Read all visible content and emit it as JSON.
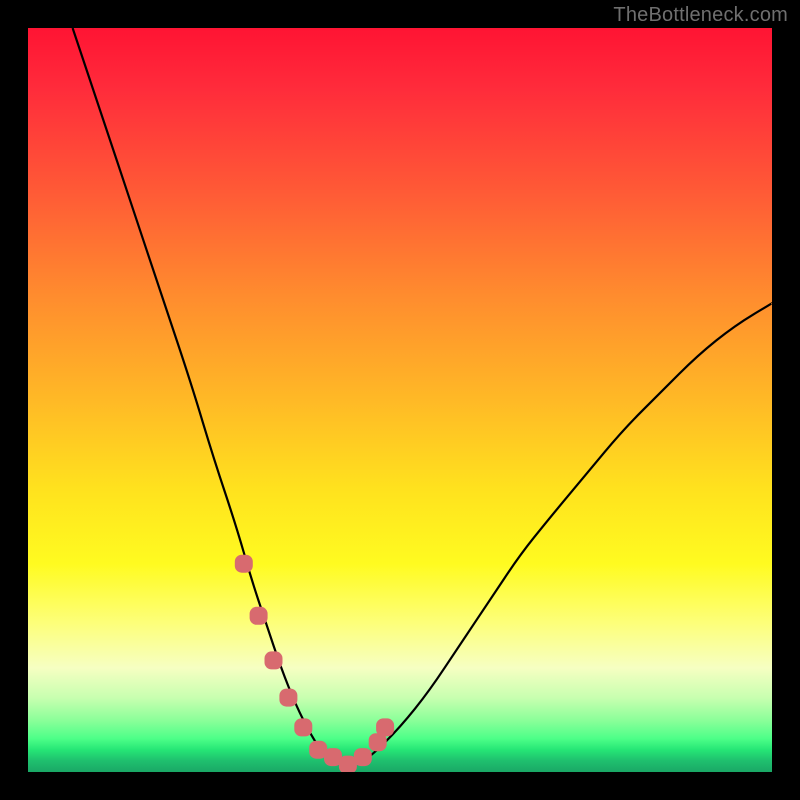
{
  "watermark": "TheBottleneck.com",
  "colors": {
    "frame": "#000000",
    "curve": "#000000",
    "marker": "#d86a6f",
    "gradient_stops": [
      "#ff1433",
      "#ff2b3b",
      "#ff5a36",
      "#ff8c2e",
      "#ffb926",
      "#ffe21e",
      "#fffb20",
      "#fdff7a",
      "#f6ffc2",
      "#c8ffb0",
      "#8cff9a",
      "#4dff88",
      "#26e676",
      "#1fbf6e",
      "#1aa866"
    ]
  },
  "chart_data": {
    "type": "line",
    "title": "",
    "xlabel": "",
    "ylabel": "",
    "xlim": [
      0,
      100
    ],
    "ylim": [
      0,
      100
    ],
    "series": [
      {
        "name": "bottleneck-curve",
        "x": [
          6,
          10,
          14,
          18,
          22,
          25,
          28,
          30,
          32,
          34,
          36,
          38,
          40,
          42,
          44,
          46,
          50,
          54,
          58,
          62,
          66,
          70,
          75,
          80,
          85,
          90,
          95,
          100
        ],
        "y": [
          100,
          88,
          76,
          64,
          52,
          42,
          33,
          26,
          20,
          14,
          9,
          5,
          2,
          1,
          1,
          2,
          6,
          11,
          17,
          23,
          29,
          34,
          40,
          46,
          51,
          56,
          60,
          63
        ]
      }
    ],
    "markers": {
      "name": "highlighted-segment",
      "x": [
        29,
        31,
        33,
        35,
        37,
        39,
        41,
        43,
        45,
        47,
        48
      ],
      "y": [
        28,
        21,
        15,
        10,
        6,
        3,
        2,
        1,
        2,
        4,
        6
      ]
    }
  }
}
